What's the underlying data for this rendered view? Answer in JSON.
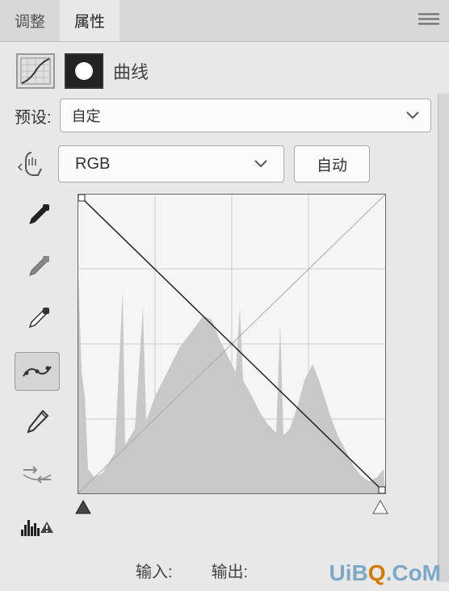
{
  "tabs": {
    "adjustments": "调整",
    "properties": "属性"
  },
  "title": "曲线",
  "preset": {
    "label": "预设:",
    "value": "自定"
  },
  "channel": {
    "value": "RGB"
  },
  "autoBtn": "自动",
  "io": {
    "input": "输入:",
    "output": "输出:"
  },
  "watermark": {
    "prefix": "UiB",
    "q": "Q",
    "suffix": ".CoM"
  }
}
